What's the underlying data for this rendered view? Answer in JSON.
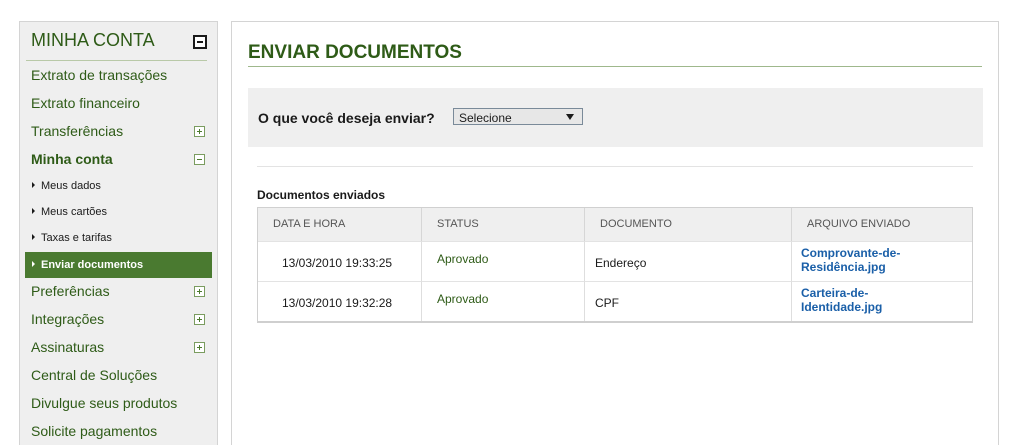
{
  "sidebar": {
    "title": "MINHA CONTA",
    "items": [
      {
        "label": "Extrato de transações"
      },
      {
        "label": "Extrato financeiro"
      },
      {
        "label": "Transferências"
      },
      {
        "label": "Minha conta"
      },
      {
        "label": "Preferências"
      },
      {
        "label": "Integrações"
      },
      {
        "label": "Assinaturas"
      },
      {
        "label": "Central de Soluções"
      },
      {
        "label": "Divulgue seus produtos"
      },
      {
        "label": "Solicite pagamentos"
      }
    ],
    "subitems": [
      {
        "label": "Meus dados"
      },
      {
        "label": "Meus cartões"
      },
      {
        "label": "Taxas e tarifas"
      },
      {
        "label": "Enviar documentos"
      }
    ]
  },
  "main": {
    "title": "ENVIAR DOCUMENTOS",
    "question": "O que você deseja enviar?",
    "select_value": "Selecione",
    "documents_title": "Documentos enviados",
    "table": {
      "headers": [
        "DATA E HORA",
        "STATUS",
        "DOCUMENTO",
        "ARQUIVO ENVIADO"
      ],
      "rows": [
        {
          "date": "13/03/2010 19:33:25",
          "status": "Aprovado",
          "document": "Endereço",
          "file": "Comprovante-de-\nResidência.jpg"
        },
        {
          "date": "13/03/2010 19:32:28",
          "status": "Aprovado",
          "document": "CPF",
          "file": "Carteira-de-\nIdentidade.jpg"
        }
      ]
    }
  },
  "colors": {
    "brand_green": "#2e5b17",
    "active_bg": "#4a7a30",
    "link_blue": "#1a5fa8"
  }
}
